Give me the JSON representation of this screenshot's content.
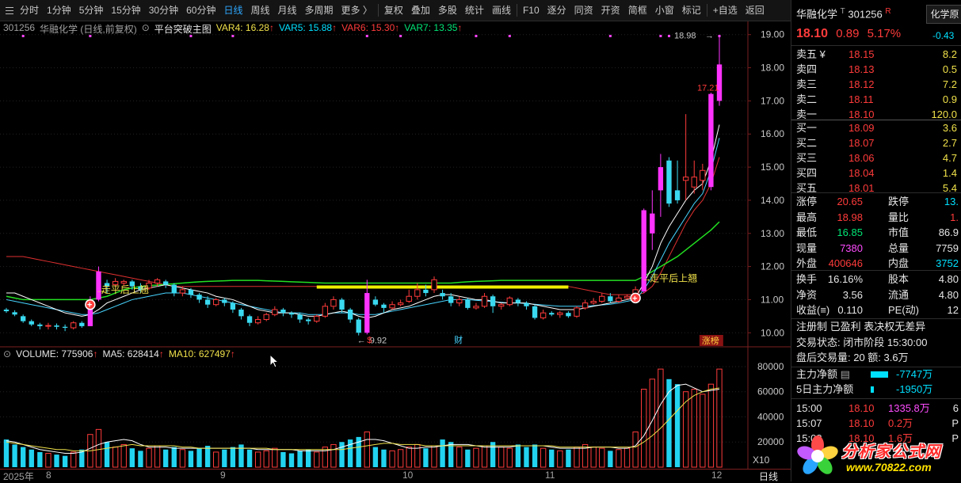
{
  "toolbar": {
    "items": [
      "分时",
      "1分钟",
      "5分钟",
      "15分钟",
      "30分钟",
      "60分钟",
      "日线",
      "周线",
      "月线",
      "多周期",
      "更多 〉",
      "复权",
      "叠加",
      "多股",
      "统计",
      "画线",
      "F10",
      "逐分",
      "同资",
      "开资",
      "简框",
      "小窗",
      "标记",
      "+自选",
      "返回"
    ],
    "active": "日线"
  },
  "chart_header": {
    "code": "301256",
    "name": "华融化学 (日线,前复权)",
    "indicator": "平台突破主图",
    "var4": "VAR4: 16.28",
    "var5": "VAR5: 15.88",
    "var6": "VAR6: 15.30",
    "var7": "VAR7: 13.35"
  },
  "volume_header": {
    "volume": "VOLUME: 775906",
    "ma5": "MA5: 628414",
    "ma10": "MA10: 627497"
  },
  "annotations": {
    "breakout1": "走平后上翘",
    "breakout2": "走平后上翘",
    "low_price": "9.92",
    "high_price": "18.98",
    "close_label": "17.21",
    "zhangting": "涨榜",
    "cai": "财",
    "dollar": "$"
  },
  "price_axis": [
    "19.00",
    "18.00",
    "17.00",
    "16.00",
    "15.00",
    "14.00",
    "13.00",
    "12.00",
    "11.00",
    "10.00"
  ],
  "volume_axis": [
    "80000",
    "60000",
    "40000",
    "20000"
  ],
  "volume_unit": "X10",
  "date_axis": [
    "2025年",
    "8",
    "9",
    "10",
    "11",
    "12"
  ],
  "period_label": "日线",
  "quote": {
    "name": "华融化学",
    "code": "301256",
    "tag": "R",
    "sector": "化学原",
    "price": "18.10",
    "change": "0.89",
    "pct": "5.17%",
    "sector_pct": "-0.43",
    "asks": [
      {
        "label": "卖五 ¥",
        "price": "18.15",
        "vol": "8.2"
      },
      {
        "label": "卖四",
        "price": "18.13",
        "vol": "0.5"
      },
      {
        "label": "卖三",
        "price": "18.12",
        "vol": "7.2"
      },
      {
        "label": "卖二",
        "price": "18.11",
        "vol": "0.9"
      },
      {
        "label": "卖一",
        "price": "18.10",
        "vol": "120.0"
      }
    ],
    "bids": [
      {
        "label": "买一",
        "price": "18.09",
        "vol": "3.6"
      },
      {
        "label": "买二",
        "price": "18.07",
        "vol": "2.7"
      },
      {
        "label": "买三",
        "price": "18.06",
        "vol": "4.7"
      },
      {
        "label": "买四",
        "price": "18.04",
        "vol": "1.4"
      },
      {
        "label": "买五",
        "price": "18.01",
        "vol": "5.4"
      }
    ],
    "stats": [
      {
        "l1": "涨停",
        "v1": "20.65",
        "l2": "跌停",
        "v2": "13."
      },
      {
        "l1": "最高",
        "v1": "18.98",
        "l2": "量比",
        "v2": "1."
      },
      {
        "l1": "最低",
        "v1": "16.85",
        "l2": "市值",
        "v2": "86.9"
      },
      {
        "l1": "现量",
        "v1": "7380",
        "l2": "总量",
        "v2": "7759"
      },
      {
        "l1": "外盘",
        "v1": "400646",
        "l2": "内盘",
        "v2": "3752"
      }
    ],
    "stats2": [
      {
        "l1": "换手",
        "v1": "16.16%",
        "l2": "股本",
        "v2": "4.80"
      },
      {
        "l1": "净资",
        "v1": "3.56",
        "l2": "流通",
        "v2": "4.80"
      },
      {
        "l1": "收益(≡)",
        "v1": "0.110",
        "l2": "PE(动)",
        "v2": "12"
      }
    ],
    "notes": "注册制 已盈利 表决权无差异",
    "trade_status": "交易状态: 闭市阶段 15:30:00",
    "after_hours": "盘后交易量: 20  额: 3.6万",
    "main_flow_label": "主力净额",
    "main_flow_value": "-7747万",
    "main_flow_5d_label": "5日主力净额",
    "main_flow_5d_value": "-1950万",
    "ticks": [
      {
        "time": "15:00",
        "price": "18.10",
        "vol": "1335.8万",
        "flag": "6"
      },
      {
        "time": "15:07",
        "price": "18.10",
        "vol": "0.2万",
        "flag": "P"
      },
      {
        "time": "15:08",
        "price": "18.10",
        "vol": "1.6万",
        "flag": "P"
      }
    ]
  },
  "watermark": {
    "line1": "分析家公式网",
    "line2": "www.70822.com"
  },
  "chart_data": {
    "type": "candlestick",
    "ylim": [
      9.6,
      19.4
    ],
    "candles": [
      [
        10.7,
        10.65,
        10.6,
        10.75
      ],
      [
        10.62,
        10.55,
        10.5,
        10.68
      ],
      [
        10.5,
        10.35,
        10.3,
        10.55
      ],
      [
        10.35,
        10.25,
        10.2,
        10.4
      ],
      [
        10.25,
        10.2,
        10.1,
        10.3
      ],
      [
        10.2,
        10.22,
        10.1,
        10.3
      ],
      [
        10.22,
        10.18,
        10.1,
        10.28
      ],
      [
        10.18,
        10.15,
        10.05,
        10.25
      ],
      [
        10.15,
        10.3,
        10.1,
        10.35
      ],
      [
        10.3,
        10.2,
        10.15,
        10.35
      ],
      [
        10.2,
        11.0,
        10.2,
        11.1
      ],
      [
        11.0,
        11.85,
        10.95,
        12.0
      ],
      [
        11.5,
        11.4,
        11.2,
        11.6
      ],
      [
        11.45,
        11.55,
        11.4,
        11.65
      ],
      [
        11.5,
        11.55,
        11.4,
        11.6
      ],
      [
        11.55,
        11.4,
        11.3,
        11.6
      ],
      [
        11.4,
        11.3,
        11.2,
        11.5
      ],
      [
        11.35,
        11.5,
        11.3,
        11.6
      ],
      [
        11.5,
        11.6,
        11.4,
        11.65
      ],
      [
        11.55,
        11.45,
        11.35,
        11.6
      ],
      [
        11.45,
        11.2,
        11.1,
        11.5
      ],
      [
        11.2,
        11.3,
        11.1,
        11.4
      ],
      [
        11.3,
        11.15,
        11.05,
        11.35
      ],
      [
        11.15,
        11.0,
        10.9,
        11.2
      ],
      [
        11.0,
        10.85,
        10.75,
        11.1
      ],
      [
        10.85,
        11.0,
        10.8,
        11.05
      ],
      [
        11.0,
        10.9,
        10.8,
        11.05
      ],
      [
        10.9,
        10.7,
        10.6,
        10.95
      ],
      [
        10.7,
        10.5,
        10.4,
        10.75
      ],
      [
        10.5,
        10.3,
        10.2,
        10.55
      ],
      [
        10.3,
        10.4,
        10.25,
        10.5
      ],
      [
        10.4,
        10.55,
        10.35,
        10.6
      ],
      [
        10.55,
        10.7,
        10.5,
        10.8
      ],
      [
        10.7,
        10.6,
        10.5,
        10.75
      ],
      [
        10.6,
        10.55,
        10.45,
        10.65
      ],
      [
        10.55,
        10.4,
        10.3,
        10.6
      ],
      [
        10.4,
        10.35,
        10.25,
        10.45
      ],
      [
        10.35,
        10.5,
        10.3,
        10.55
      ],
      [
        10.5,
        10.8,
        10.45,
        10.9
      ],
      [
        10.8,
        11.0,
        10.7,
        11.1
      ],
      [
        11.0,
        10.7,
        10.6,
        11.05
      ],
      [
        10.7,
        10.4,
        10.3,
        10.75
      ],
      [
        10.4,
        10.0,
        9.92,
        10.45
      ],
      [
        10.0,
        11.2,
        9.95,
        11.6
      ],
      [
        11.0,
        10.85,
        10.8,
        11.1
      ],
      [
        10.85,
        10.75,
        10.6,
        10.9
      ],
      [
        10.75,
        10.85,
        10.7,
        10.95
      ],
      [
        10.85,
        10.9,
        10.8,
        11.0
      ],
      [
        10.95,
        11.1,
        10.9,
        11.3
      ],
      [
        11.1,
        11.3,
        11.0,
        11.5
      ],
      [
        11.3,
        11.2,
        11.1,
        11.45
      ],
      [
        11.3,
        11.6,
        11.2,
        11.7
      ],
      [
        11.2,
        11.1,
        11.0,
        11.3
      ],
      [
        11.1,
        10.9,
        10.8,
        11.2
      ],
      [
        10.9,
        11.0,
        10.8,
        11.1
      ],
      [
        11.0,
        10.75,
        10.7,
        11.05
      ],
      [
        10.75,
        10.8,
        10.7,
        10.9
      ],
      [
        10.8,
        11.1,
        10.75,
        11.2
      ],
      [
        11.1,
        10.8,
        10.6,
        11.15
      ],
      [
        10.8,
        10.85,
        10.7,
        10.9
      ],
      [
        10.85,
        11.05,
        10.8,
        11.1
      ],
      [
        11.0,
        10.9,
        10.8,
        11.05
      ],
      [
        10.9,
        10.8,
        10.7,
        10.95
      ],
      [
        10.8,
        10.45,
        10.4,
        10.85
      ],
      [
        10.45,
        10.6,
        10.4,
        10.7
      ],
      [
        10.6,
        10.55,
        10.5,
        10.65
      ],
      [
        10.55,
        10.6,
        10.45,
        10.65
      ],
      [
        10.6,
        10.5,
        10.45,
        10.65
      ],
      [
        10.5,
        10.75,
        10.45,
        10.8
      ],
      [
        10.75,
        10.9,
        10.7,
        11.0
      ],
      [
        10.9,
        10.95,
        10.85,
        11.05
      ],
      [
        10.95,
        11.1,
        10.9,
        11.2
      ],
      [
        11.1,
        10.95,
        10.9,
        11.2
      ],
      [
        10.95,
        11.05,
        10.9,
        11.15
      ],
      [
        11.05,
        11.1,
        11.0,
        11.15
      ],
      [
        11.1,
        11.3,
        11.05,
        11.4
      ],
      [
        11.25,
        13.7,
        11.2,
        13.75
      ],
      [
        13.0,
        13.6,
        12.5,
        14.3
      ],
      [
        14.3,
        15.0,
        13.5,
        15.4
      ],
      [
        15.2,
        13.9,
        13.8,
        15.3
      ],
      [
        14.3,
        14.0,
        13.9,
        15.2
      ],
      [
        14.6,
        14.7,
        14.0,
        16.6
      ],
      [
        14.4,
        14.7,
        14.2,
        15.2
      ],
      [
        14.6,
        14.9,
        14.3,
        15.1
      ],
      [
        14.4,
        17.21,
        14.3,
        17.25
      ],
      [
        17.0,
        18.1,
        16.85,
        18.98
      ]
    ],
    "volumes": [
      22,
      18,
      16,
      14,
      12,
      11,
      10,
      9,
      12,
      14,
      26,
      30,
      20,
      16,
      18,
      15,
      13,
      15,
      17,
      14,
      16,
      14,
      13,
      15,
      17,
      12,
      14,
      16,
      18,
      14,
      12,
      13,
      15,
      12,
      11,
      13,
      14,
      12,
      16,
      18,
      20,
      22,
      24,
      28,
      16,
      14,
      13,
      14,
      16,
      18,
      15,
      17,
      22,
      20,
      16,
      14,
      15,
      17,
      20,
      16,
      15,
      18,
      16,
      18,
      15,
      14,
      13,
      14,
      16,
      18,
      16,
      15,
      13,
      14,
      15,
      28,
      62,
      70,
      78,
      70,
      66,
      60,
      62,
      58,
      66,
      78
    ],
    "ma5": [
      21,
      20,
      18,
      16,
      14,
      13,
      12,
      11,
      11,
      12,
      15,
      18,
      20,
      21,
      22,
      21,
      18,
      16,
      16,
      16,
      15,
      15,
      15,
      15,
      15,
      15,
      15,
      15,
      15,
      15,
      14,
      14,
      14,
      14,
      14,
      13,
      13,
      13,
      13,
      14,
      16,
      18,
      20,
      22,
      22,
      21,
      19,
      17,
      15,
      15,
      16,
      16,
      17,
      18,
      18,
      18,
      17,
      16,
      16,
      16,
      16,
      17,
      17,
      17,
      17,
      16,
      15,
      15,
      15,
      15,
      16,
      16,
      16,
      15,
      15,
      17,
      25,
      37,
      50,
      60,
      65,
      66,
      63,
      60,
      61,
      62
    ],
    "ma10": [
      20,
      19,
      18,
      17,
      16,
      15,
      14,
      14,
      13,
      13,
      13,
      14,
      15,
      16,
      17,
      18,
      17,
      17,
      17,
      17,
      17,
      16,
      16,
      15,
      15,
      15,
      15,
      15,
      15,
      15,
      15,
      15,
      14,
      14,
      14,
      14,
      14,
      14,
      14,
      14,
      14,
      15,
      16,
      17,
      18,
      19,
      19,
      18,
      18,
      18,
      17,
      17,
      17,
      17,
      17,
      17,
      17,
      17,
      17,
      17,
      17,
      17,
      17,
      17,
      17,
      17,
      16,
      16,
      16,
      16,
      16,
      16,
      16,
      16,
      16,
      16,
      20,
      25,
      31,
      38,
      45,
      52,
      57,
      60,
      62,
      63
    ],
    "ma_yellow": [
      11.2,
      11.2,
      11.1,
      11.0,
      10.9,
      10.8,
      10.7,
      10.6,
      10.55,
      10.5,
      10.55,
      10.7,
      10.9,
      11.0,
      11.1,
      11.2,
      11.3,
      11.35,
      11.4,
      11.45,
      11.4,
      11.35,
      11.3,
      11.25,
      11.2,
      11.1,
      11.05,
      11.0,
      10.9,
      10.8,
      10.7,
      10.65,
      10.6,
      10.6,
      10.6,
      10.55,
      10.5,
      10.5,
      10.55,
      10.6,
      10.65,
      10.6,
      10.5,
      10.45,
      10.5,
      10.6,
      10.7,
      10.75,
      10.8,
      10.9,
      11.0,
      11.1,
      11.15,
      11.15,
      11.1,
      11.05,
      11.0,
      11.0,
      10.95,
      10.9,
      10.9,
      10.9,
      10.9,
      10.85,
      10.8,
      10.75,
      10.7,
      10.7,
      10.7,
      10.75,
      10.8,
      10.85,
      10.9,
      10.95,
      11.0,
      11.05,
      11.5,
      12.0,
      12.7,
      13.2,
      13.6,
      14.0,
      14.3,
      14.5,
      15.2,
      16.28
    ],
    "ma_cyan": [
      11.0,
      10.95,
      10.9,
      10.85,
      10.8,
      10.75,
      10.7,
      10.65,
      10.6,
      10.55,
      10.55,
      10.6,
      10.7,
      10.8,
      10.9,
      11.0,
      11.05,
      11.1,
      11.15,
      11.2,
      11.2,
      11.2,
      11.15,
      11.1,
      11.05,
      11.0,
      10.95,
      10.9,
      10.85,
      10.8,
      10.75,
      10.7,
      10.65,
      10.6,
      10.6,
      10.6,
      10.55,
      10.55,
      10.55,
      10.6,
      10.6,
      10.6,
      10.55,
      10.55,
      10.55,
      10.6,
      10.65,
      10.7,
      10.75,
      10.8,
      10.85,
      10.9,
      10.95,
      11.0,
      11.0,
      11.0,
      10.98,
      10.96,
      10.94,
      10.92,
      10.9,
      10.9,
      10.88,
      10.86,
      10.84,
      10.82,
      10.8,
      10.8,
      10.8,
      10.8,
      10.82,
      10.84,
      10.86,
      10.9,
      10.95,
      11.0,
      11.3,
      11.7,
      12.2,
      12.7,
      13.1,
      13.5,
      13.9,
      14.2,
      14.9,
      15.88
    ],
    "ma_red": [
      12.3,
      12.3,
      12.3,
      12.25,
      12.2,
      12.15,
      12.1,
      12.05,
      12.0,
      11.95,
      11.9,
      11.85,
      11.8,
      11.75,
      11.7,
      11.65,
      11.6,
      11.55,
      11.5,
      11.45,
      11.4,
      11.4,
      11.4,
      11.4,
      11.4,
      11.4,
      11.4,
      11.4,
      11.4,
      11.4,
      11.4,
      11.4,
      11.4,
      11.4,
      11.4,
      11.4,
      11.4,
      11.4,
      11.4,
      11.4,
      11.4,
      11.4,
      11.4,
      11.4,
      11.4,
      11.4,
      11.4,
      11.4,
      11.4,
      11.4,
      11.4,
      11.4,
      11.4,
      11.4,
      11.4,
      11.4,
      11.4,
      11.4,
      11.4,
      11.4,
      11.4,
      11.4,
      11.4,
      11.4,
      11.4,
      11.4,
      11.4,
      11.4,
      11.35,
      11.3,
      11.25,
      11.2,
      11.15,
      11.15,
      11.15,
      11.15,
      11.2,
      11.4,
      11.8,
      12.3,
      12.8,
      13.3,
      13.7,
      14.0,
      14.5,
      15.3
    ],
    "ma_green": [
      11.1,
      11.05,
      11.0,
      11.0,
      11.0,
      11.0,
      11.0,
      11.0,
      11.0,
      11.0,
      11.0,
      11.05,
      11.1,
      11.2,
      11.3,
      11.35,
      11.4,
      11.42,
      11.44,
      11.46,
      11.48,
      11.5,
      11.52,
      11.54,
      11.55,
      11.56,
      11.57,
      11.58,
      11.58,
      11.58,
      11.58,
      11.57,
      11.56,
      11.55,
      11.54,
      11.53,
      11.52,
      11.51,
      11.5,
      11.5,
      11.5,
      11.5,
      11.5,
      11.5,
      11.5,
      11.5,
      11.5,
      11.5,
      11.5,
      11.5,
      11.5,
      11.5,
      11.5,
      11.5,
      11.52,
      11.54,
      11.55,
      11.56,
      11.57,
      11.58,
      11.58,
      11.58,
      11.58,
      11.58,
      11.58,
      11.58,
      11.58,
      11.58,
      11.58,
      11.58,
      11.58,
      11.58,
      11.58,
      11.58,
      11.58,
      11.58,
      11.7,
      11.85,
      12.0,
      12.15,
      12.3,
      12.5,
      12.7,
      12.9,
      13.1,
      13.35
    ],
    "platform_line": 11.38
  }
}
